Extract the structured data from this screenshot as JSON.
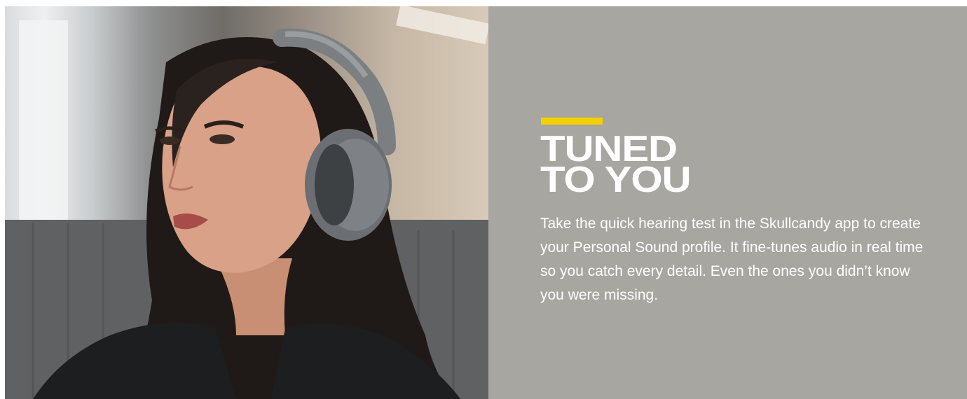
{
  "hero": {
    "image_alt": "Woman wearing gray over-ear headphones",
    "accent_color": "#f5d000",
    "panel_color": "#a7a6a1",
    "headline": {
      "line1": "TUNED",
      "line2": "TO YOU"
    },
    "body": "Take the quick hearing test in the Skullcandy app to create your Personal Sound profile. It fine-tunes audio in real time so you catch every detail. Even the ones you didn’t know you were missing."
  }
}
